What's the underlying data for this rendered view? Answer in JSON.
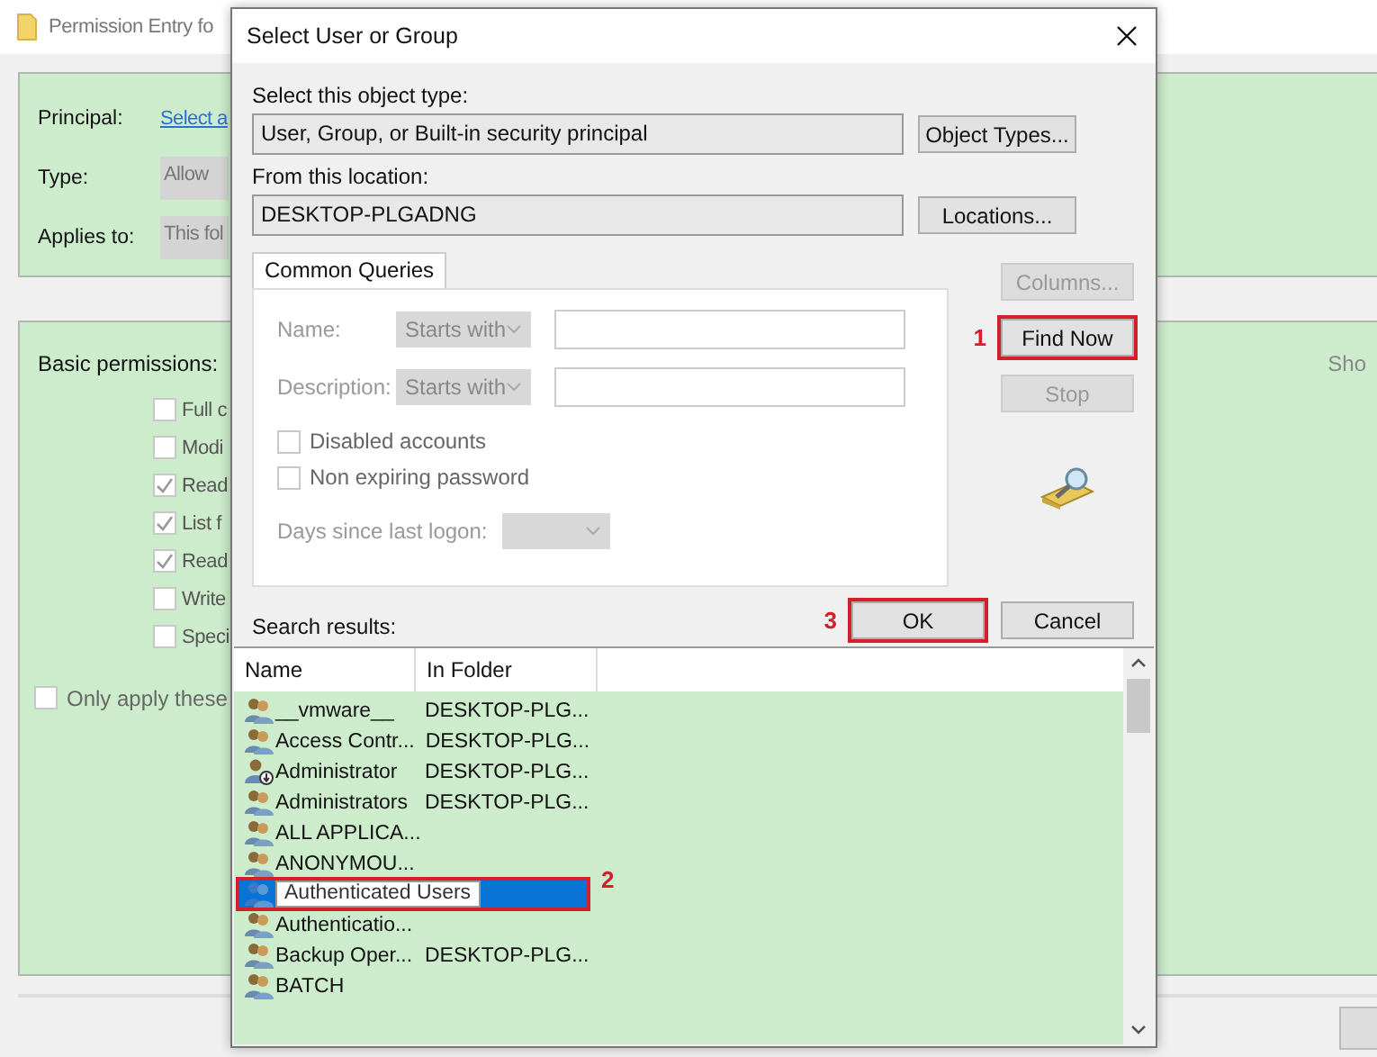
{
  "background_window": {
    "title": "Permission Entry fo",
    "principal_label": "Principal:",
    "principal_link": "Select a",
    "type_label": "Type:",
    "type_value": "Allow",
    "applies_label": "Applies to:",
    "applies_value": "This fol",
    "basic_label": "Basic permissions:",
    "show_text": "Sho",
    "permissions": [
      {
        "label": "Full c",
        "checked": false
      },
      {
        "label": "Modi",
        "checked": false
      },
      {
        "label": "Read",
        "checked": true
      },
      {
        "label": "List f",
        "checked": true
      },
      {
        "label": "Read",
        "checked": true
      },
      {
        "label": "Write",
        "checked": false
      },
      {
        "label": "Speci",
        "checked": false
      }
    ],
    "only_apply": {
      "label": "Only apply these",
      "checked": false
    }
  },
  "dialog": {
    "title": "Select User or Group",
    "object_type_label": "Select this object type:",
    "object_type_value": "User, Group, or Built-in security principal",
    "object_types_button": "Object Types...",
    "location_label": "From this location:",
    "location_value": "DESKTOP-PLGADNG",
    "locations_button": "Locations...",
    "query_tab": "Common Queries",
    "name_label": "Name:",
    "name_match": "Starts with",
    "description_label": "Description:",
    "description_match": "Starts with",
    "query_checks": [
      {
        "label": "Disabled accounts",
        "checked": false
      },
      {
        "label": "Non expiring password",
        "checked": false
      }
    ],
    "days_label": "Days since last logon:",
    "side_buttons": [
      {
        "label": "Columns...",
        "disabled": true,
        "highlighted": false
      },
      {
        "label": "Find Now",
        "disabled": false,
        "highlighted": true,
        "step": "1"
      },
      {
        "label": "Stop",
        "disabled": true,
        "highlighted": false
      }
    ],
    "search_results_label": "Search results:",
    "buttons": [
      {
        "label": "OK",
        "highlighted": true,
        "step": "3"
      },
      {
        "label": "Cancel",
        "highlighted": false
      }
    ],
    "columns": [
      "Name",
      "In Folder"
    ],
    "rows": [
      {
        "name": "__vmware__",
        "folder": "DESKTOP-PLG...",
        "kind": "group",
        "selected": false
      },
      {
        "name": "Access Contr...",
        "folder": "DESKTOP-PLG...",
        "kind": "group",
        "selected": false
      },
      {
        "name": "Administrator",
        "folder": "DESKTOP-PLG...",
        "kind": "user",
        "selected": false
      },
      {
        "name": "Administrators",
        "folder": "DESKTOP-PLG...",
        "kind": "group",
        "selected": false
      },
      {
        "name": "ALL APPLICA...",
        "kind": "group",
        "selected": false
      },
      {
        "name": "ANONYMOU...",
        "kind": "group",
        "selected": false
      },
      {
        "name": "Authenticated Users",
        "kind": "group",
        "selected": true,
        "highlighted": true,
        "step": "2"
      },
      {
        "name": "Authenticatio...",
        "kind": "group",
        "selected": false
      },
      {
        "name": "Backup Oper...",
        "folder": "DESKTOP-PLG...",
        "kind": "group",
        "selected": false
      },
      {
        "name": "BATCH",
        "kind": "group",
        "selected": false
      }
    ]
  }
}
